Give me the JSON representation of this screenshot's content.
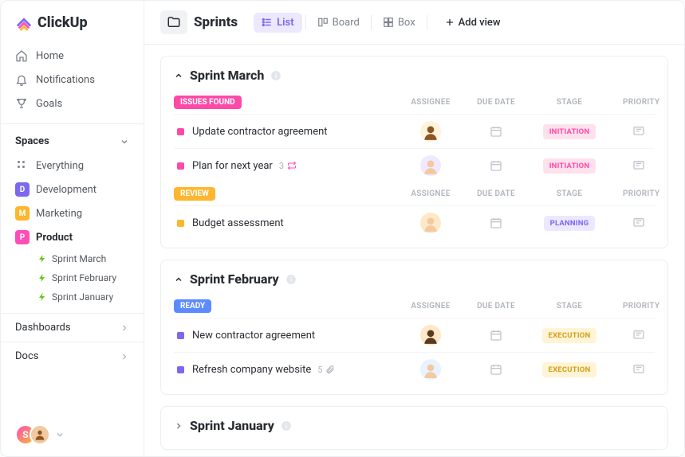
{
  "brand": "ClickUp",
  "nav": {
    "home": "Home",
    "notifications": "Notifications",
    "goals": "Goals"
  },
  "spaces_label": "Spaces",
  "spaces": {
    "everything": "Everything",
    "development": {
      "label": "Development",
      "initial": "D"
    },
    "marketing": {
      "label": "Marketing",
      "initial": "M"
    },
    "product": {
      "label": "Product",
      "initial": "P"
    },
    "product_items": [
      "Sprint  March",
      "Sprint  February",
      "Sprint January"
    ]
  },
  "side": {
    "dashboards": "Dashboards",
    "docs": "Docs"
  },
  "footer_user_initial": "S",
  "page_title": "Sprints",
  "views": {
    "list": "List",
    "board": "Board",
    "box": "Box",
    "add": "Add view"
  },
  "columns": {
    "assignee": "ASSIGNEE",
    "due": "DUE DATE",
    "stage": "STAGE",
    "priority": "PRIORITY"
  },
  "sprints": [
    {
      "title": "Sprint March",
      "expanded": true,
      "groups": [
        {
          "tag": "ISSUES FOUND",
          "tag_color": "pink",
          "tasks": [
            {
              "name": "Update contractor agreement",
              "dot": "pink",
              "avatar": {
                "bg": "#fff3db",
                "ring": "#fff3db",
                "face": "#8d5524"
              },
              "stage": "INITIATION",
              "stage_class": "initiation"
            },
            {
              "name": "Plan for next year",
              "dot": "pink",
              "meta_count": "3",
              "meta_icon": "repeat",
              "avatar": {
                "bg": "#f1e9ff",
                "face": "#f2c9a0"
              },
              "stage": "INITIATION",
              "stage_class": "initiation"
            }
          ]
        },
        {
          "tag": "REVIEW",
          "tag_color": "yellow",
          "tasks": [
            {
              "name": "Budget assessment",
              "dot": "yellow",
              "avatar": {
                "bg": "#ffe8c7",
                "face": "#f2c9a0"
              },
              "stage": "PLANNING",
              "stage_class": "planning"
            }
          ]
        }
      ]
    },
    {
      "title": "Sprint February",
      "expanded": true,
      "groups": [
        {
          "tag": "READY",
          "tag_color": "blue",
          "tasks": [
            {
              "name": "New contractor agreement",
              "dot": "purple",
              "avatar": {
                "bg": "#ffe8c7",
                "face": "#5b3a1f"
              },
              "stage": "EXECUTION",
              "stage_class": "execution"
            },
            {
              "name": "Refresh company website",
              "dot": "purple",
              "meta_count": "5",
              "meta_icon": "attach",
              "avatar": {
                "bg": "#e8f3ff",
                "face": "#f2c9a0"
              },
              "stage": "EXECUTION",
              "stage_class": "execution"
            }
          ]
        }
      ]
    },
    {
      "title": "Sprint January",
      "expanded": false
    }
  ]
}
